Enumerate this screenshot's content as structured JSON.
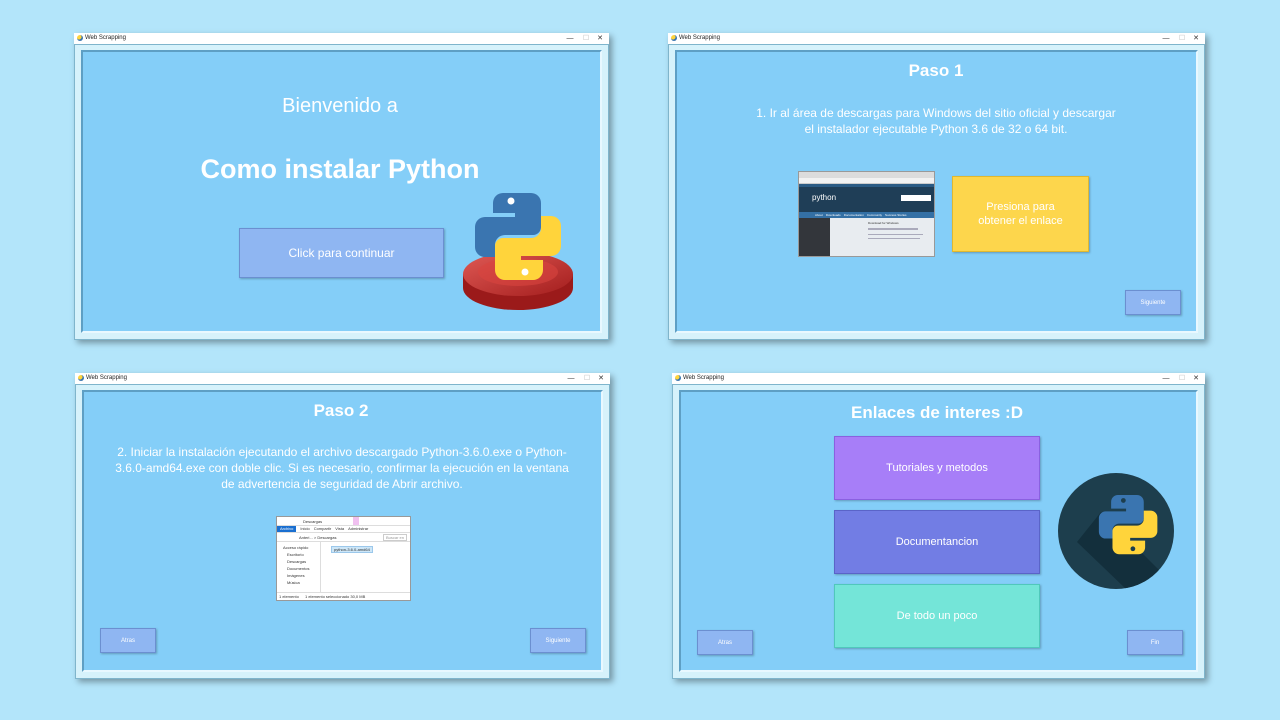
{
  "window_title": "Web Scrapping",
  "window_controls": {
    "minimize": "—",
    "maximize": "☐",
    "close": "✕"
  },
  "screens": {
    "welcome": {
      "greeting": "Bienvenido a",
      "headline": "Como instalar Python",
      "continue_label": "Click para continuar"
    },
    "step1": {
      "title": "Paso 1",
      "instruction": "1. Ir al área de descargas para Windows del sitio oficial y descargar el instalador ejecutable Python 3.6 de 32 o 64 bit.",
      "link_button_label": "Presiona para obtener el enlace",
      "next_label": "Siguiente",
      "screenshot": {
        "logo_text": "python",
        "nav_items": [
          "About",
          "Downloads",
          "Documentation",
          "Community",
          "Success Stories"
        ],
        "download_heading": "Download for Windows"
      }
    },
    "step2": {
      "title": "Paso 2",
      "instruction": "2. Iniciar la instalación ejecutando el archivo descargado Python-3.6.0.exe o Python-3.6.0-amd64.exe con doble clic. Si es necesario, confirmar la ejecución en la ventana de advertencia de seguridad de Abrir archivo.",
      "back_label": "Atras",
      "next_label": "Siguiente",
      "explorer": {
        "title": "Descargas",
        "ribbon_tabs": [
          "Archivo",
          "Inicio",
          "Compartir",
          "Vista",
          "Administrar"
        ],
        "path": "Anteri... > Descargas",
        "search_placeholder": "Buscar en",
        "sidebar": [
          "Acceso rápido",
          "Escritorio",
          "Descargas",
          "Documentos",
          "Imágenes",
          "Música"
        ],
        "file_name": "python-3.6.0-amd64",
        "status_left": "1 elemento",
        "status_mid": "1 elemento seleccionado  30,0 MB"
      }
    },
    "links": {
      "title": "Enlaces de interes :D",
      "tutorials_label": "Tutoriales y metodos",
      "docs_label": "Documentancion",
      "misc_label": "De todo un poco",
      "back_label": "Atras",
      "end_label": "Fin",
      "colors": {
        "tutorials": "#a77ef8",
        "docs": "#727de4",
        "misc": "#74e5d8",
        "badge": "#1d3e4d"
      }
    }
  },
  "colors": {
    "page_bg": "#b3e5fa",
    "panel": "#84cef8",
    "accent_yellow": "#fdd64c",
    "python_blue": "#3a75b0",
    "python_yellow": "#ffd43b",
    "pedestal_red": "#c42828"
  }
}
